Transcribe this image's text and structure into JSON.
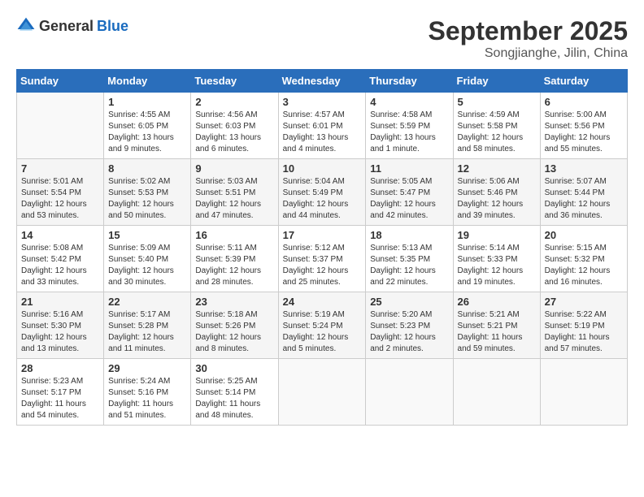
{
  "header": {
    "logo_general": "General",
    "logo_blue": "Blue",
    "month": "September 2025",
    "location": "Songjianghe, Jilin, China"
  },
  "weekdays": [
    "Sunday",
    "Monday",
    "Tuesday",
    "Wednesday",
    "Thursday",
    "Friday",
    "Saturday"
  ],
  "weeks": [
    [
      {
        "day": "",
        "info": ""
      },
      {
        "day": "1",
        "info": "Sunrise: 4:55 AM\nSunset: 6:05 PM\nDaylight: 13 hours\nand 9 minutes."
      },
      {
        "day": "2",
        "info": "Sunrise: 4:56 AM\nSunset: 6:03 PM\nDaylight: 13 hours\nand 6 minutes."
      },
      {
        "day": "3",
        "info": "Sunrise: 4:57 AM\nSunset: 6:01 PM\nDaylight: 13 hours\nand 4 minutes."
      },
      {
        "day": "4",
        "info": "Sunrise: 4:58 AM\nSunset: 5:59 PM\nDaylight: 13 hours\nand 1 minute."
      },
      {
        "day": "5",
        "info": "Sunrise: 4:59 AM\nSunset: 5:58 PM\nDaylight: 12 hours\nand 58 minutes."
      },
      {
        "day": "6",
        "info": "Sunrise: 5:00 AM\nSunset: 5:56 PM\nDaylight: 12 hours\nand 55 minutes."
      }
    ],
    [
      {
        "day": "7",
        "info": "Sunrise: 5:01 AM\nSunset: 5:54 PM\nDaylight: 12 hours\nand 53 minutes."
      },
      {
        "day": "8",
        "info": "Sunrise: 5:02 AM\nSunset: 5:53 PM\nDaylight: 12 hours\nand 50 minutes."
      },
      {
        "day": "9",
        "info": "Sunrise: 5:03 AM\nSunset: 5:51 PM\nDaylight: 12 hours\nand 47 minutes."
      },
      {
        "day": "10",
        "info": "Sunrise: 5:04 AM\nSunset: 5:49 PM\nDaylight: 12 hours\nand 44 minutes."
      },
      {
        "day": "11",
        "info": "Sunrise: 5:05 AM\nSunset: 5:47 PM\nDaylight: 12 hours\nand 42 minutes."
      },
      {
        "day": "12",
        "info": "Sunrise: 5:06 AM\nSunset: 5:46 PM\nDaylight: 12 hours\nand 39 minutes."
      },
      {
        "day": "13",
        "info": "Sunrise: 5:07 AM\nSunset: 5:44 PM\nDaylight: 12 hours\nand 36 minutes."
      }
    ],
    [
      {
        "day": "14",
        "info": "Sunrise: 5:08 AM\nSunset: 5:42 PM\nDaylight: 12 hours\nand 33 minutes."
      },
      {
        "day": "15",
        "info": "Sunrise: 5:09 AM\nSunset: 5:40 PM\nDaylight: 12 hours\nand 30 minutes."
      },
      {
        "day": "16",
        "info": "Sunrise: 5:11 AM\nSunset: 5:39 PM\nDaylight: 12 hours\nand 28 minutes."
      },
      {
        "day": "17",
        "info": "Sunrise: 5:12 AM\nSunset: 5:37 PM\nDaylight: 12 hours\nand 25 minutes."
      },
      {
        "day": "18",
        "info": "Sunrise: 5:13 AM\nSunset: 5:35 PM\nDaylight: 12 hours\nand 22 minutes."
      },
      {
        "day": "19",
        "info": "Sunrise: 5:14 AM\nSunset: 5:33 PM\nDaylight: 12 hours\nand 19 minutes."
      },
      {
        "day": "20",
        "info": "Sunrise: 5:15 AM\nSunset: 5:32 PM\nDaylight: 12 hours\nand 16 minutes."
      }
    ],
    [
      {
        "day": "21",
        "info": "Sunrise: 5:16 AM\nSunset: 5:30 PM\nDaylight: 12 hours\nand 13 minutes."
      },
      {
        "day": "22",
        "info": "Sunrise: 5:17 AM\nSunset: 5:28 PM\nDaylight: 12 hours\nand 11 minutes."
      },
      {
        "day": "23",
        "info": "Sunrise: 5:18 AM\nSunset: 5:26 PM\nDaylight: 12 hours\nand 8 minutes."
      },
      {
        "day": "24",
        "info": "Sunrise: 5:19 AM\nSunset: 5:24 PM\nDaylight: 12 hours\nand 5 minutes."
      },
      {
        "day": "25",
        "info": "Sunrise: 5:20 AM\nSunset: 5:23 PM\nDaylight: 12 hours\nand 2 minutes."
      },
      {
        "day": "26",
        "info": "Sunrise: 5:21 AM\nSunset: 5:21 PM\nDaylight: 11 hours\nand 59 minutes."
      },
      {
        "day": "27",
        "info": "Sunrise: 5:22 AM\nSunset: 5:19 PM\nDaylight: 11 hours\nand 57 minutes."
      }
    ],
    [
      {
        "day": "28",
        "info": "Sunrise: 5:23 AM\nSunset: 5:17 PM\nDaylight: 11 hours\nand 54 minutes."
      },
      {
        "day": "29",
        "info": "Sunrise: 5:24 AM\nSunset: 5:16 PM\nDaylight: 11 hours\nand 51 minutes."
      },
      {
        "day": "30",
        "info": "Sunrise: 5:25 AM\nSunset: 5:14 PM\nDaylight: 11 hours\nand 48 minutes."
      },
      {
        "day": "",
        "info": ""
      },
      {
        "day": "",
        "info": ""
      },
      {
        "day": "",
        "info": ""
      },
      {
        "day": "",
        "info": ""
      }
    ]
  ]
}
